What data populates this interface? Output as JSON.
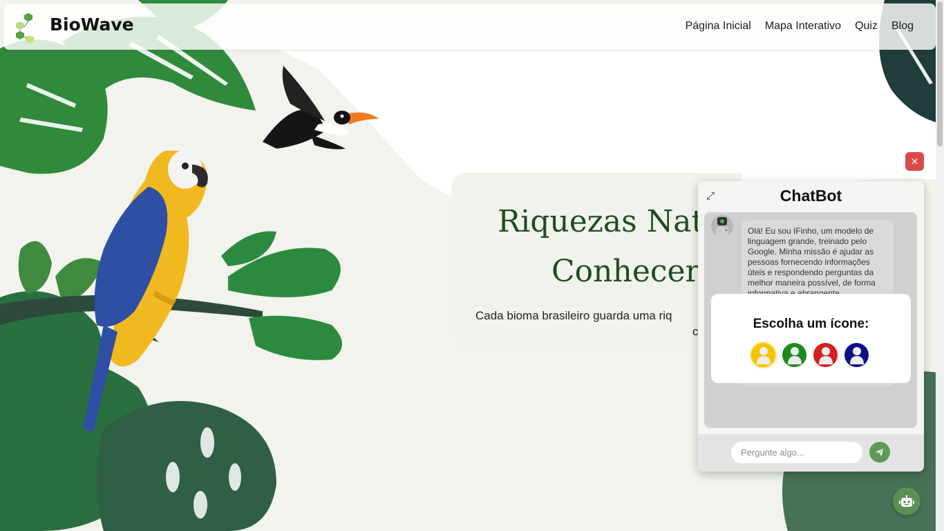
{
  "header": {
    "brand": "BioWave",
    "nav": [
      {
        "label": "Página Inicial"
      },
      {
        "label": "Mapa Interativo"
      },
      {
        "label": "Quiz"
      },
      {
        "label": "Blog"
      }
    ]
  },
  "hero": {
    "title_line1": "Riquezas Natu",
    "title_line2": "Conhecer",
    "subtitle_line1": "Cada bioma brasileiro guarda uma riq",
    "subtitle_line2": "c"
  },
  "chat": {
    "close_glyph": "×",
    "expand_glyph": "⤢",
    "title": "ChatBot",
    "bot_message": "Olá! Eu sou IFinho, um modelo de linguagem grande, treinado pelo Google. Minha missão é ajudar as pessoas fornecendo informações úteis e respondendo perguntas da melhor maneira possível, de forma informativa e abrangente.",
    "icon_picker": {
      "title": "Escolha um ícone:",
      "options": [
        {
          "name": "yellow",
          "color": "#f3c400"
        },
        {
          "name": "green",
          "color": "#1e8a1e"
        },
        {
          "name": "red",
          "color": "#d61f1f"
        },
        {
          "name": "blue",
          "color": "#0d0f8a"
        }
      ]
    },
    "input_placeholder": "Pergunte algo..."
  },
  "colors": {
    "accent_green": "#5e9b57",
    "title_green": "#1f4d20",
    "close_red": "#d94a4a"
  },
  "icons": [
    "leaf-logo-icon",
    "expand-icon",
    "close-icon",
    "send-icon",
    "robot-icon",
    "user-icon"
  ]
}
